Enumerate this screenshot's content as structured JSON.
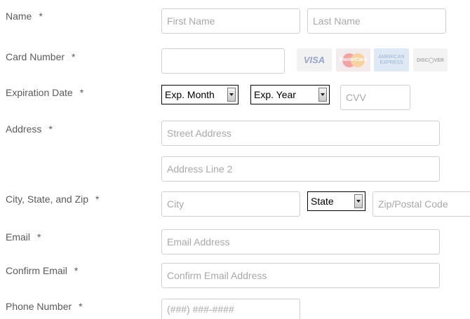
{
  "labels": {
    "name": "Name",
    "card_number": "Card Number",
    "expiration": "Expiration Date",
    "address": "Address",
    "city_state_zip": "City, State, and Zip",
    "email": "Email",
    "confirm_email": "Confirm Email",
    "phone": "Phone Number",
    "required_marker": "*"
  },
  "placeholders": {
    "first_name": "First Name",
    "last_name": "Last Name",
    "card_number": "",
    "cvv": "CVV",
    "street": "Street Address",
    "address2": "Address Line 2",
    "city": "City",
    "zip": "Zip/Postal Code",
    "email": "Email Address",
    "confirm_email": "Confirm Email Address",
    "phone": "(###) ###-####"
  },
  "selects": {
    "exp_month": "Exp. Month",
    "exp_year": "Exp. Year",
    "state": "State"
  },
  "cards": {
    "visa": "VISA",
    "mastercard": "MasterCard",
    "amex_line1": "AMERICAN",
    "amex_line2": "EXPRESS",
    "discover": "DISC◯VER"
  }
}
